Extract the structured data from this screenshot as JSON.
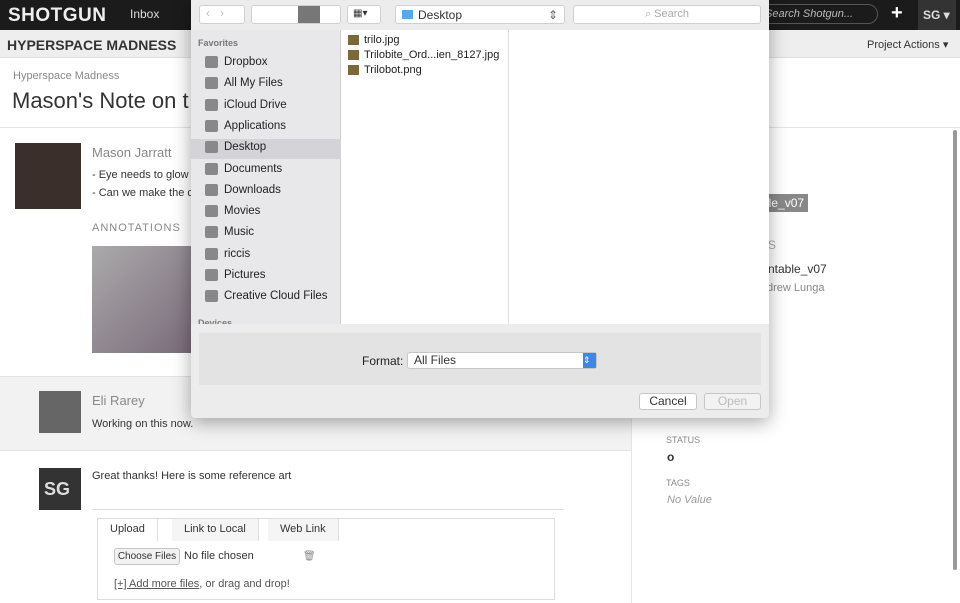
{
  "topbar": {
    "logo": "SHOTGUN",
    "inbox": "Inbox",
    "search_placeholder": "Search Shotgun...",
    "plus": "+",
    "user": "SG ▾"
  },
  "project": {
    "name": "HYPERSPACE MADNESS",
    "actions": "Project Actions ▾"
  },
  "page": {
    "breadcrumb": "Hyperspace Madness",
    "title": "Mason's Note on t"
  },
  "note": {
    "author": "Mason Jarratt",
    "lines": [
      "- Eye needs to glow",
      "- Can we make the c"
    ],
    "annotations": "ANNOTATIONS"
  },
  "reply1": {
    "author": "Eli Rarey",
    "text": "Working on this now."
  },
  "reply2": {
    "avatar": "SG",
    "text": "Great thanks! Here is some reference art"
  },
  "upload": {
    "tabs": [
      "Upload",
      "Link to Local",
      "Web Link"
    ],
    "choose": "Choose Files",
    "nofile": "No file chosen",
    "add_more": "[+] Add more files",
    "drag": ", or drag and drop!"
  },
  "right": {
    "version_tag": "ble_v07",
    "section": "S",
    "version": "rntable_v07",
    "user": "drew Lunga",
    "status_label": "STATUS",
    "status_value": "o",
    "tags_label": "TAGS",
    "tags_value": "No Value"
  },
  "dialog": {
    "location": "Desktop",
    "search_placeholder": "Search",
    "favorites_label": "Favorites",
    "favorites": [
      "Dropbox",
      "All My Files",
      "iCloud Drive",
      "Applications",
      "Desktop",
      "Documents",
      "Downloads",
      "Movies",
      "Music",
      "riccis",
      "Pictures",
      "Creative Cloud Files"
    ],
    "devices_label": "Devices",
    "files": [
      "trilo.jpg",
      "Trilobite_Ord...ien_8127.jpg",
      "Trilobot.png"
    ],
    "format_label": "Format:",
    "format_value": "All Files",
    "cancel": "Cancel",
    "open": "Open"
  }
}
